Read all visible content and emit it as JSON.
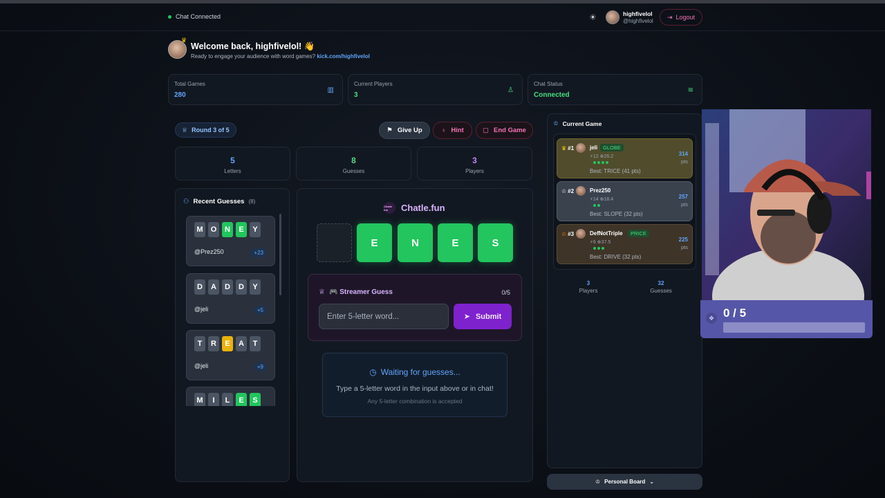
{
  "header": {
    "chat_status": "Chat Connected",
    "user_name": "highfivelol",
    "user_handle": "@highfivelol",
    "logout_label": "Logout"
  },
  "welcome": {
    "title": "Welcome back, highfivelol! 👋",
    "subtitle": "Ready to engage your audience with word games?",
    "link": "kick.com/highfivelol"
  },
  "stats": [
    {
      "label": "Total Games",
      "value": "280",
      "color": "#60a5fa",
      "icon": "chart-icon"
    },
    {
      "label": "Current Players",
      "value": "3",
      "color": "#4ade80",
      "icon": "person-icon"
    },
    {
      "label": "Chat Status",
      "value": "Connected",
      "color": "#4ade80",
      "icon": "wifi-icon"
    }
  ],
  "game": {
    "round_label": "Round 3 of 5",
    "give_up_label": "Give Up",
    "hint_label": "Hint",
    "end_label": "End Game",
    "mini_stats": [
      {
        "value": "5",
        "label": "Letters",
        "color": "#60a5fa"
      },
      {
        "value": "8",
        "label": "Guesses",
        "color": "#4ade80"
      },
      {
        "value": "3",
        "label": "Players",
        "color": "#c084fc"
      }
    ],
    "brand_logo": "Chatle fun",
    "brand_name": "Chatle.fun",
    "board_tiles": [
      "",
      "E",
      "N",
      "E",
      "S"
    ],
    "streamer_title": "🎮 Streamer Guess",
    "streamer_count": "0/5",
    "input_placeholder": "Enter 5-letter word...",
    "submit_label": "Submit",
    "waiting_title": "Waiting for guesses...",
    "waiting_sub": "Type a 5-letter word in the input above or in chat!",
    "waiting_note": "Any 5-letter combination is accepted"
  },
  "recent": {
    "title": "Recent Guesses",
    "count": "(8)",
    "items": [
      {
        "letters": [
          "M",
          "O",
          "N",
          "E",
          "Y"
        ],
        "states": [
          "x",
          "x",
          "g",
          "g",
          "x"
        ],
        "user": "@Prez250",
        "pts": "+23"
      },
      {
        "letters": [
          "D",
          "A",
          "D",
          "D",
          "Y"
        ],
        "states": [
          "x",
          "x",
          "x",
          "x",
          "x"
        ],
        "user": "@jeli",
        "pts": "+5"
      },
      {
        "letters": [
          "T",
          "R",
          "E",
          "A",
          "T"
        ],
        "states": [
          "x",
          "x",
          "y",
          "x",
          "x"
        ],
        "user": "@jeli",
        "pts": "+9"
      },
      {
        "letters": [
          "M",
          "I",
          "L",
          "E",
          "S"
        ],
        "states": [
          "x",
          "x",
          "x",
          "g",
          "g"
        ],
        "user": "",
        "pts": ""
      }
    ]
  },
  "current_game": {
    "title": "Current Game",
    "players": [
      {
        "rank": "#1",
        "name": "jeli",
        "tag": "GLOBE",
        "stats": "⚡12 ⊕26.2",
        "dots": 4,
        "best": "Best: TRICE (41 pts)",
        "pts": "314",
        "pts_label": "pts"
      },
      {
        "rank": "#2",
        "name": "Prez250",
        "tag": "",
        "stats": "⚡14 ⊕18.4",
        "dots": 2,
        "best": "Best: SLOPE (32 pts)",
        "pts": "257",
        "pts_label": "pts"
      },
      {
        "rank": "#3",
        "name": "DefNotTriple",
        "tag": "PRICE",
        "stats": "⚡6 ⊕37.5",
        "dots": 3,
        "best": "Best: DRIVE (32 pts)",
        "pts": "225",
        "pts_label": "pts"
      }
    ],
    "footer": [
      {
        "value": "3",
        "label": "Players"
      },
      {
        "value": "32",
        "label": "Guesses"
      }
    ],
    "board_button": "Personal Board"
  },
  "overlay": {
    "score": "0 / 5",
    "progress": 0
  }
}
